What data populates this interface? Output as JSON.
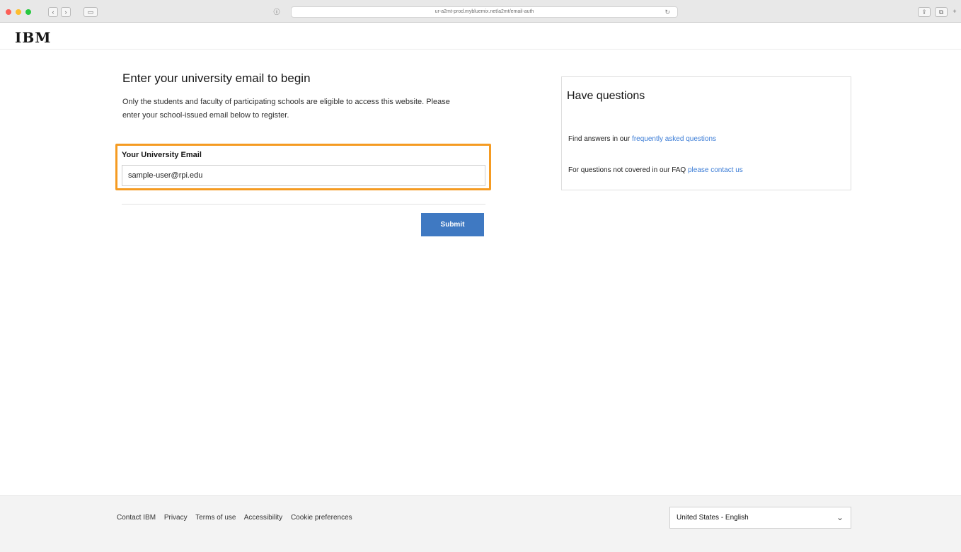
{
  "browser": {
    "url": "ur-a2mt-prod.mybluemix.net/a2mt/email-auth",
    "info_icon": "ⓘ",
    "reload_icon": "↻"
  },
  "header": {
    "logo": "IBM"
  },
  "main": {
    "title": "Enter your university email to begin",
    "description_line1": "Only the students and faculty of participating schools are eligible to access this website. Please",
    "description_line2": "enter your school-issued email below to register.",
    "email_label": "Your University Email",
    "email_value": "sample-user@rpi.edu",
    "submit_label": "Submit"
  },
  "help": {
    "title": "Have questions",
    "faq_prefix": "Find answers in our ",
    "faq_link": "frequently asked questions",
    "contact_prefix": "For questions not covered in our FAQ ",
    "contact_link": "please contact us"
  },
  "footer": {
    "links": [
      "Contact IBM",
      "Privacy",
      "Terms of use",
      "Accessibility",
      "Cookie preferences"
    ],
    "locale": "United States - English"
  },
  "colors": {
    "accent_blue": "#3f79c2",
    "highlight_orange": "#f59b22",
    "link_blue": "#3b7cd6"
  }
}
